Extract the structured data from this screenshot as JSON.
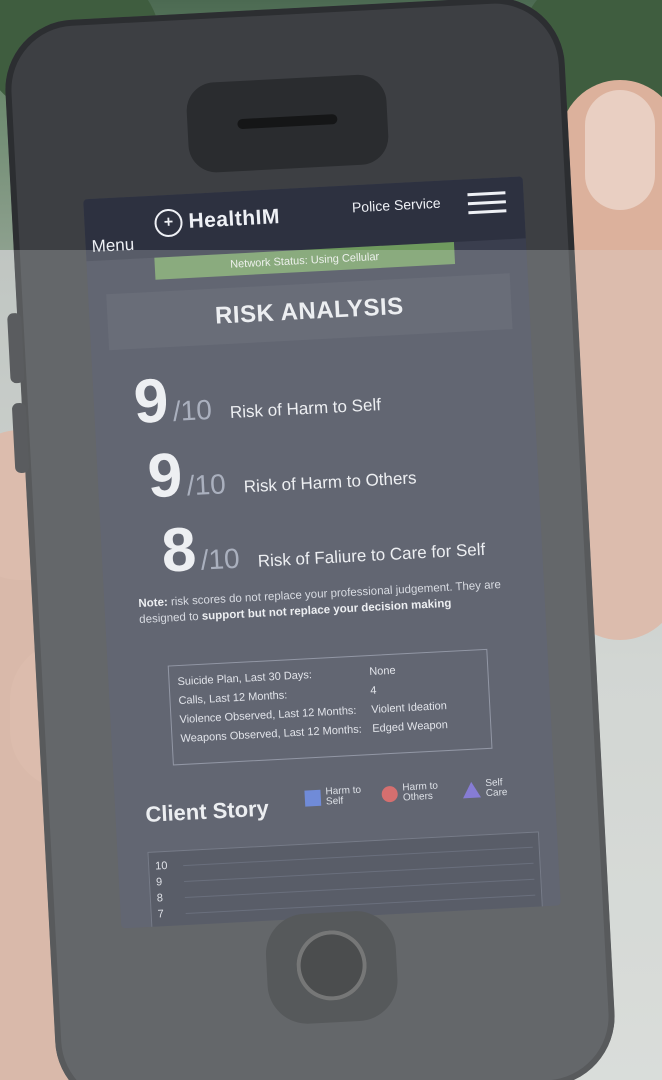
{
  "app": {
    "menu_label": "Menu",
    "brand": "HealthIM",
    "service": "Police Service",
    "network_status": "Network Status: Using Cellular"
  },
  "risk_analysis": {
    "title": "RISK ANALYSIS",
    "items": [
      {
        "score": "9",
        "denominator": "/10",
        "label": "Risk of Harm to Self"
      },
      {
        "score": "9",
        "denominator": "/10",
        "label": "Risk of Harm to Others"
      },
      {
        "score": "8",
        "denominator": "/10",
        "label": "Risk of Faliure to Care for Self"
      }
    ],
    "note_prefix": "Note:",
    "note_text": "risk scores do not replace your professional judgement. They are designed to",
    "note_bold": "support but not replace your decision making"
  },
  "details": [
    {
      "label": "Suicide Plan, Last 30 Days:",
      "value": "None"
    },
    {
      "label": "Calls, Last 12 Months:",
      "value": "4"
    },
    {
      "label": "Violence Observed, Last 12 Months:",
      "value": "Violent Ideation"
    },
    {
      "label": "Weapons Observed, Last 12 Months:",
      "value": "Edged Weapon"
    }
  ],
  "client_story": {
    "title": "Client Story",
    "legend": [
      {
        "label": "Harm to Self",
        "shape": "square",
        "color": "#4d6fd6"
      },
      {
        "label": "Harm to Others",
        "shape": "circle",
        "color": "#d34a4a"
      },
      {
        "label": "Self Care",
        "shape": "triangle",
        "color": "#6a5bd0"
      }
    ],
    "y_ticks": [
      "10",
      "9",
      "8",
      "7"
    ]
  }
}
